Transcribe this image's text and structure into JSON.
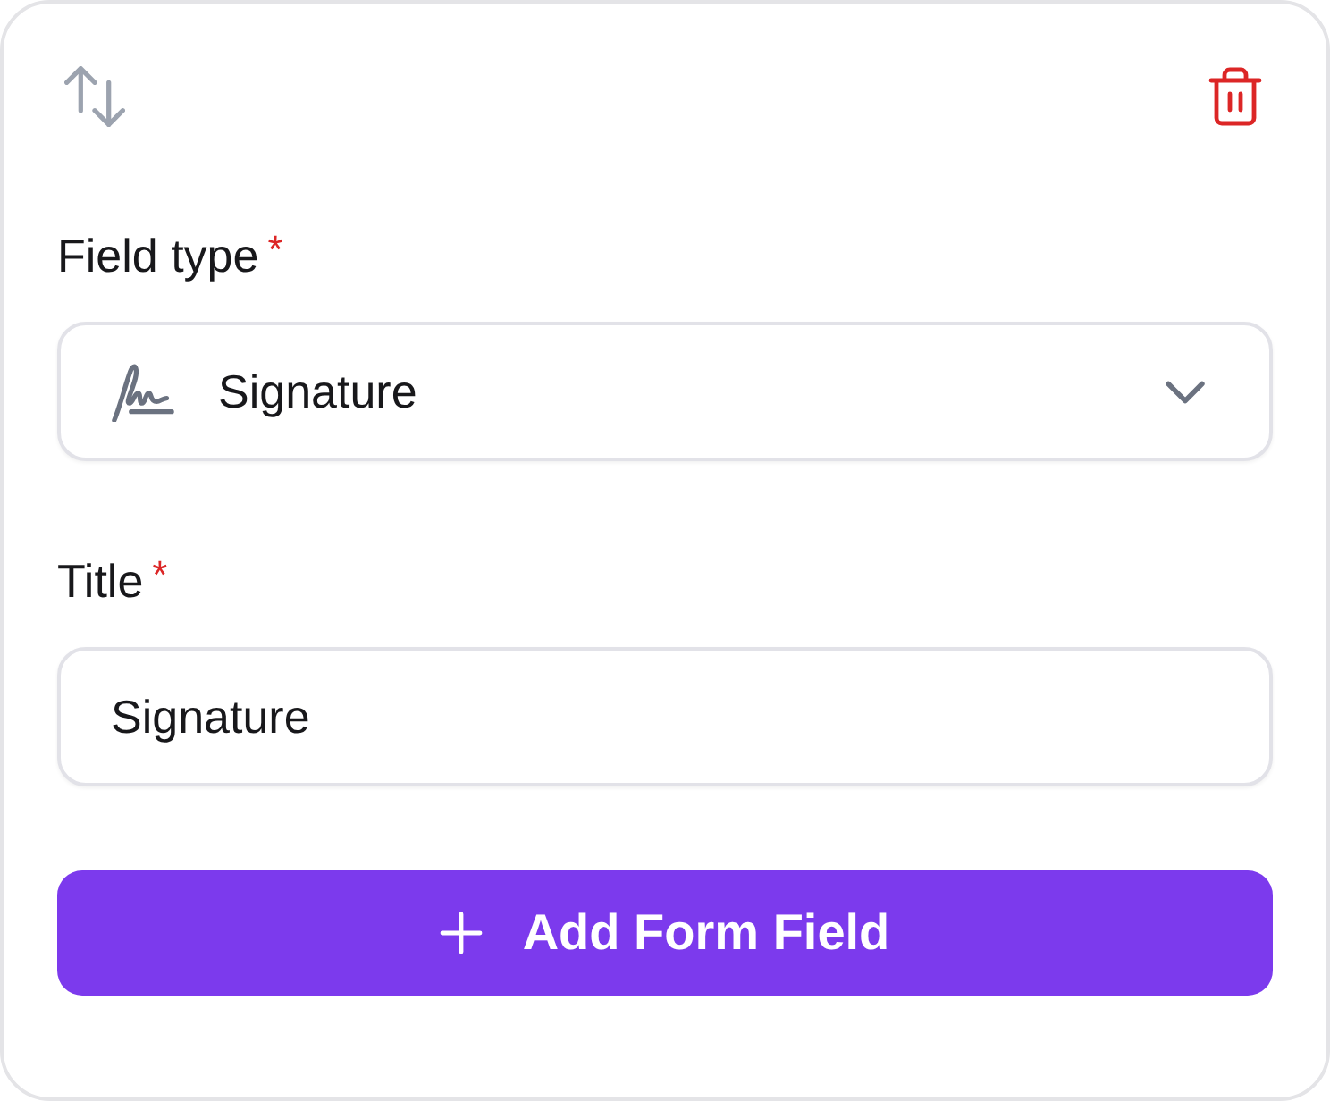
{
  "fields": [
    {
      "kind": "select",
      "label": "Field type",
      "required_mark": "*",
      "value": "Signature"
    },
    {
      "kind": "text",
      "label": "Title",
      "required_mark": "*",
      "value": "Signature"
    }
  ],
  "add_button": {
    "label": "Add Form Field"
  }
}
